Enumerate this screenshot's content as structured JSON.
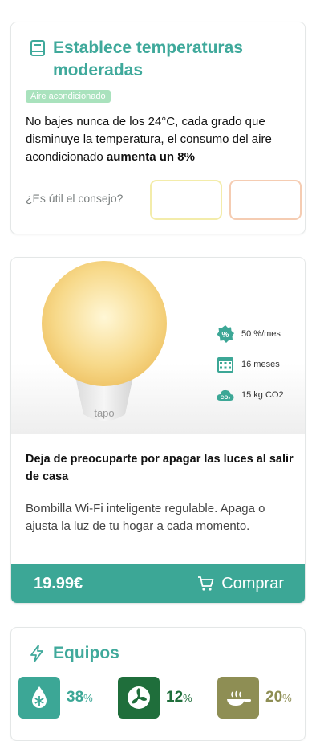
{
  "tip": {
    "title": "Establece temperaturas moderadas",
    "tag": "Aire acondicionado",
    "body_part1": "No bajes nunca de los 24°C, cada grado que disminuye la temperatura, el consumo del aire acondicionado ",
    "body_bold": "aumenta un 8%",
    "useful_question": "¿Es útil el consejo?",
    "icon": "book-icon",
    "colors": {
      "accent": "#3fa99b",
      "tag_bg": "#a9e2bd",
      "yes_border": "#f3ecaa",
      "no_border": "#f5ccb2"
    }
  },
  "product": {
    "image_brand": "tapo",
    "stats": [
      {
        "icon": "percent-badge-icon",
        "text": "50 %/mes"
      },
      {
        "icon": "calendar-icon",
        "text": "16 meses"
      },
      {
        "icon": "co2-cloud-icon",
        "text": "15 kg CO2"
      }
    ],
    "title": "Deja de preocuparte por apagar las luces al salir de casa",
    "description": "Bombilla Wi-Fi inteligente regulable. Apaga o ajusta la luz de tu hogar a cada momento.",
    "price": "19.99€",
    "buy_label": "Comprar",
    "colors": {
      "buy_bar": "#3ca796"
    }
  },
  "equipment": {
    "title": "Equipos",
    "items": [
      {
        "icon": "ac-snowflake-icon",
        "value": "38",
        "unit": "%",
        "color": "#3ca796"
      },
      {
        "icon": "fan-icon",
        "value": "12",
        "unit": "%",
        "color": "#1f6e3b"
      },
      {
        "icon": "pan-icon",
        "value": "20",
        "unit": "%",
        "color": "#8e8e54"
      }
    ]
  }
}
